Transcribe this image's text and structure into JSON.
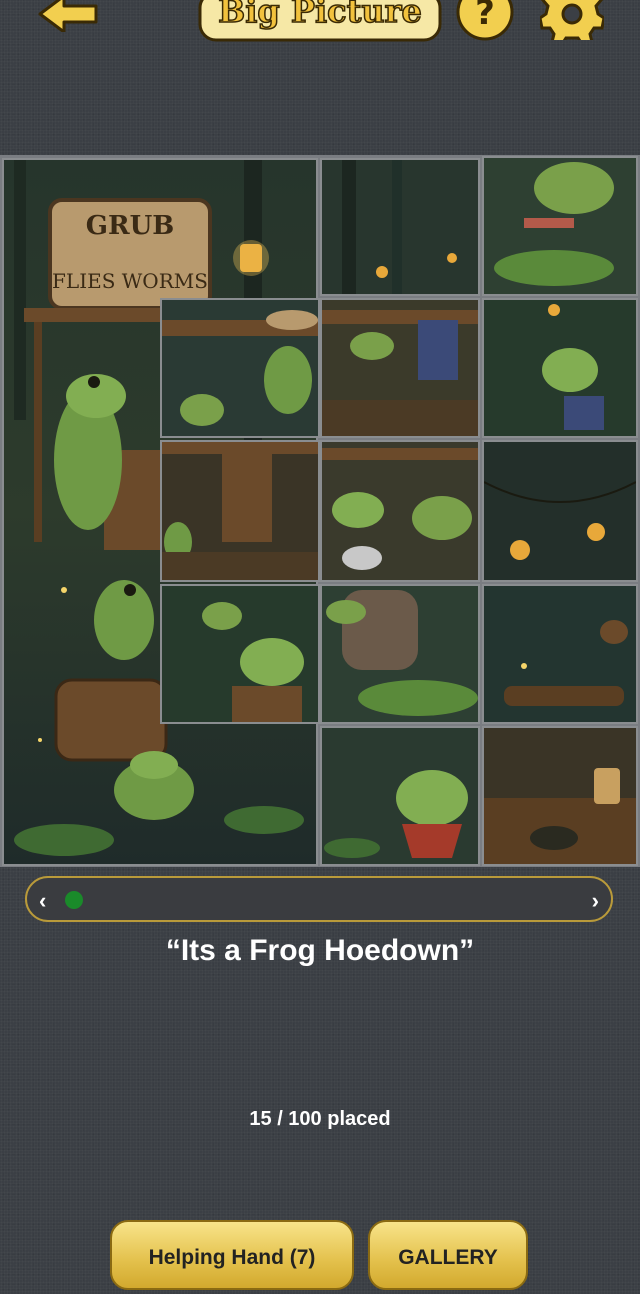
{
  "header": {
    "logo_text": "Big Picture",
    "back_icon": "back-arrow-icon",
    "help_icon": "question-mark-icon",
    "settings_icon": "gear-icon"
  },
  "puzzle": {
    "title": "“Its a Frog Hoedown”",
    "progress_text": "15 / 100 placed",
    "placed": 15,
    "total": 100,
    "sign_lines": [
      "GRUB",
      "FLIES WORMS"
    ]
  },
  "scrubber": {
    "left_label": "‹",
    "right_label": "›"
  },
  "buttons": {
    "helping_hand": "Helping Hand (7)",
    "gallery": "GALLERY"
  },
  "colors": {
    "background": "#3b3f45",
    "gold": "#e3c04b",
    "scrub_thumb": "#1a8a2a"
  }
}
